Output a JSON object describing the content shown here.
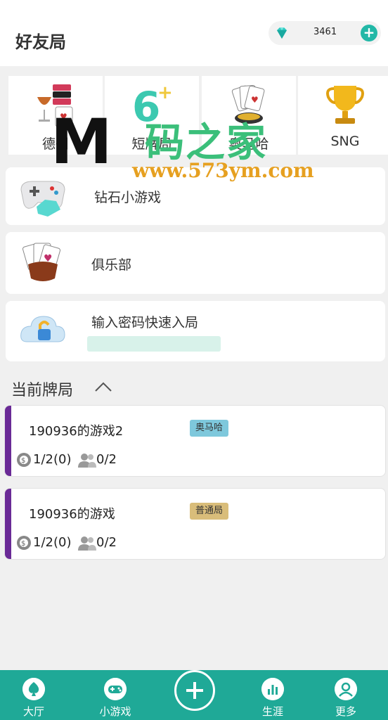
{
  "header": {
    "title": "好友局",
    "diamonds": "3461",
    "gem_icon": "diamond-icon",
    "add_icon": "plus-icon",
    "accent": "#22b8a7"
  },
  "modes": [
    {
      "label": "德州",
      "icon": "wine-chips-icon"
    },
    {
      "label": "短牌局",
      "icon": "six-plus-icon"
    },
    {
      "label": "奥马哈",
      "icon": "cards-chips-icon"
    },
    {
      "label": "SNG",
      "icon": "trophy-icon"
    }
  ],
  "menu": {
    "diamond_games": {
      "label": "钻石小游戏",
      "icon": "gamepad-icon"
    },
    "club": {
      "label": "俱乐部",
      "icon": "cards-icon"
    },
    "password": {
      "label": "输入密码快速入局",
      "icon": "cloud-lock-icon"
    }
  },
  "section": {
    "title": "当前牌局",
    "chevron": "chevron-up-icon"
  },
  "games": [
    {
      "name": "190936的游戏2",
      "tag": "奥马哈",
      "tag_color": "#7ec8dc",
      "blinds": "1/2(0)",
      "players": "0/2"
    },
    {
      "name": "190936的游戏",
      "tag": "普通局",
      "tag_color": "#d9bd7a",
      "blinds": "1/2(0)",
      "players": "0/2"
    }
  ],
  "nav": {
    "lobby": "大厅",
    "mini_games": "小游戏",
    "career": "生涯",
    "more": "更多",
    "bar_color": "#1fa997"
  },
  "watermark": {
    "big": "码之家",
    "url": "www.573ym.com",
    "logo": "M"
  }
}
